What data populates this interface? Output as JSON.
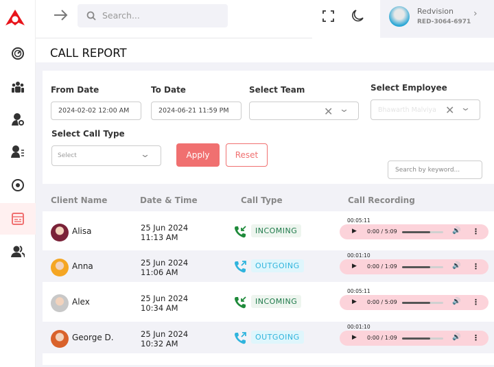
{
  "app": {
    "brand_color": "#e8141b",
    "accent": "#f07070"
  },
  "topbar": {
    "search_placeholder": "Search...",
    "profile": {
      "name": "Redvision",
      "code": "RED-3064-6971"
    }
  },
  "sidebar": {
    "items": [
      "dashboard-icon",
      "team-icon",
      "user-settings-icon",
      "user-list-icon",
      "record-icon",
      "call-report-icon",
      "users-icon"
    ],
    "active": 5
  },
  "page": {
    "title": "CALL REPORT"
  },
  "filters": {
    "from_date": {
      "label": "From Date",
      "value": "2024-02-02 12:00 AM"
    },
    "to_date": {
      "label": "To Date",
      "value": "2024-06-21 11:59 PM"
    },
    "team": {
      "label": "Select Team",
      "value": ""
    },
    "employee": {
      "label": "Select Employee",
      "value": "Bhawarth Malviya"
    },
    "call_type": {
      "label": "Select Call Type",
      "placeholder": "Select"
    },
    "apply": "Apply",
    "reset": "Reset",
    "search_placeholder": "Search by keyword..."
  },
  "table": {
    "headers": [
      "Client Name",
      "Date & Time",
      "Call Type",
      "Call Recording"
    ],
    "rows": [
      {
        "name": "Alisa",
        "date": "25 Jun 2024",
        "time": "11:13 AM",
        "type": "INCOMING",
        "duration": "00:05:11",
        "player": "0:00 / 5:09",
        "avatar": "#7a2238"
      },
      {
        "name": "Anna",
        "date": "25 Jun 2024",
        "time": "11:06 AM",
        "type": "OUTGOING",
        "duration": "00:01:10",
        "player": "0:00 / 1:09",
        "avatar": "#f5a623"
      },
      {
        "name": "Alex",
        "date": "25 Jun 2024",
        "time": "10:34 AM",
        "type": "INCOMING",
        "duration": "00:05:11",
        "player": "0:00 / 5:09",
        "avatar": "#c8c8c8"
      },
      {
        "name": "George D.",
        "date": "25 Jun 2024",
        "time": "10:32 AM",
        "type": "OUTGOING",
        "duration": "00:01:10",
        "player": "0:00 / 1:09",
        "avatar": "#d9622b"
      }
    ]
  }
}
